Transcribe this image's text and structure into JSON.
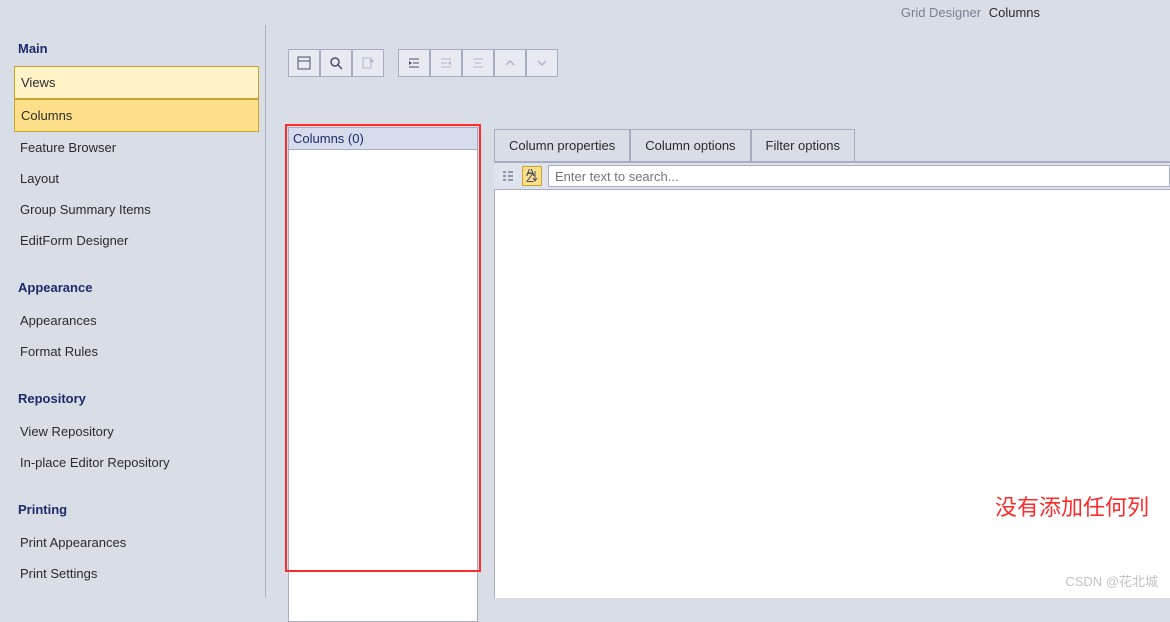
{
  "header": {
    "prefix": "Grid Designer",
    "current": "Columns"
  },
  "sidebar": {
    "groups": [
      {
        "title": "Main",
        "items": [
          {
            "label": "Views",
            "state": "hov"
          },
          {
            "label": "Columns",
            "state": "sel"
          },
          {
            "label": "Feature Browser",
            "state": ""
          },
          {
            "label": "Layout",
            "state": ""
          },
          {
            "label": "Group Summary Items",
            "state": ""
          },
          {
            "label": "EditForm Designer",
            "state": ""
          }
        ]
      },
      {
        "title": "Appearance",
        "items": [
          {
            "label": "Appearances",
            "state": ""
          },
          {
            "label": "Format Rules",
            "state": ""
          }
        ]
      },
      {
        "title": "Repository",
        "items": [
          {
            "label": "View Repository",
            "state": ""
          },
          {
            "label": "In-place Editor Repository",
            "state": ""
          }
        ]
      },
      {
        "title": "Printing",
        "items": [
          {
            "label": "Print Appearances",
            "state": ""
          },
          {
            "label": "Print Settings",
            "state": ""
          }
        ]
      }
    ]
  },
  "columns_panel": {
    "header": "Columns (0)"
  },
  "tabs": [
    "Column properties",
    "Column options",
    "Filter options"
  ],
  "active_tab": 0,
  "search": {
    "placeholder": "Enter text to search..."
  },
  "annotation": "没有添加任何列",
  "watermark": "CSDN @花北城",
  "toolbar_icons": [
    "layout-icon",
    "search-icon",
    "export-icon",
    "indent-icon",
    "decrease-indent-icon",
    "align-icon",
    "chevron-up-icon",
    "chevron-down-icon"
  ]
}
